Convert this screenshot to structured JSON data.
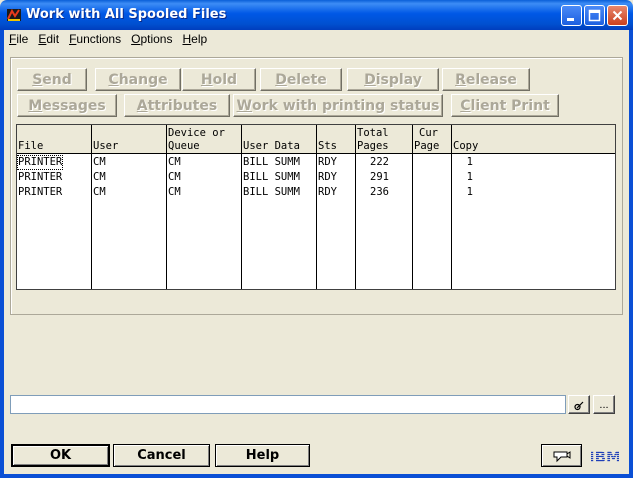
{
  "window": {
    "title": "Work with All Spooled Files",
    "icon": "as400-app-icon",
    "controls": [
      "minimize-icon",
      "maximize-icon",
      "close-icon"
    ]
  },
  "menubar": [
    {
      "label": "File",
      "accel": "F",
      "rest": "ile"
    },
    {
      "label": "Edit",
      "accel": "E",
      "rest": "dit"
    },
    {
      "label": "Functions",
      "accel": "F",
      "rest": "unctions"
    },
    {
      "label": "Options",
      "accel": "O",
      "rest": "ptions"
    },
    {
      "label": "Help",
      "accel": "H",
      "rest": "elp"
    }
  ],
  "actions_row1": [
    {
      "label": "Send",
      "accel": "S",
      "rest": "end"
    },
    {
      "label": "Change",
      "accel": "C",
      "rest": "hange"
    },
    {
      "label": "Hold",
      "accel": "H",
      "rest": "old"
    },
    {
      "label": "Delete",
      "accel": "D",
      "rest": "elete"
    },
    {
      "label": "Display",
      "accel": "D",
      "rest": "isplay"
    },
    {
      "label": "Release",
      "accel": "R",
      "rest": "elease"
    }
  ],
  "actions_row2": [
    {
      "label": "Messages",
      "accel": "M",
      "rest": "essages"
    },
    {
      "label": "Attributes",
      "accel": "A",
      "rest": "ttributes"
    },
    {
      "label": "Work with printing status",
      "accel": "W",
      "rest": "ork with printing status"
    },
    {
      "label": "Client Print",
      "accel": "C",
      "rest": "lient Print"
    }
  ],
  "table": {
    "headers": [
      {
        "line1": "",
        "line2": "File"
      },
      {
        "line1": "",
        "line2": "User"
      },
      {
        "line1": "Device or",
        "line2": "Queue"
      },
      {
        "line1": "",
        "line2": "User Data"
      },
      {
        "line1": "",
        "line2": "Sts"
      },
      {
        "line1": "Total",
        "line2": "Pages"
      },
      {
        "line1": "Cur",
        "line2": "Page"
      },
      {
        "line1": "",
        "line2": "Copy"
      }
    ],
    "rows": [
      [
        "PRINTER",
        "CM",
        "CM",
        "BILL SUMM",
        "RDY",
        "222",
        "",
        "1"
      ],
      [
        "PRINTER",
        "CM",
        "CM",
        "BILL SUMM",
        "RDY",
        "291",
        "",
        "1"
      ],
      [
        "PRINTER",
        "CM",
        "CM",
        "BILL SUMM",
        "RDY",
        "236",
        "",
        "1"
      ]
    ]
  },
  "command_line": {
    "value": "",
    "prompt_icon": "prompt-icon",
    "browse_label": "..."
  },
  "footer": {
    "ok_label": "OK",
    "cancel_label": "Cancel",
    "help_label": "Help",
    "macro_icon": "macro-icon",
    "ibm_logo_text": "IBM"
  },
  "colors": {
    "titlebar": "#0058e6",
    "dialog_bg": "#ece9d8",
    "disabled_text": "#aca899",
    "ibm_blue": "#1f3fb8"
  }
}
